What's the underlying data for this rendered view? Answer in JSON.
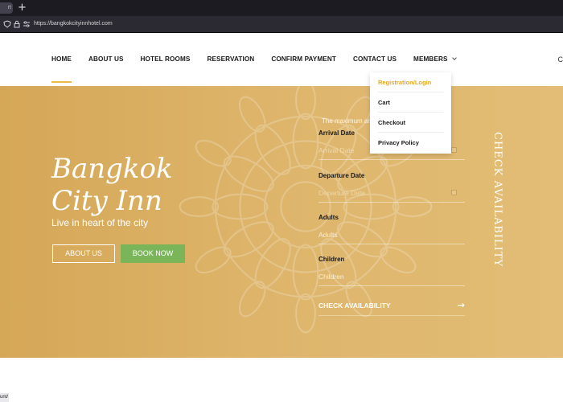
{
  "browser": {
    "tab_stub_label": "rt",
    "new_tab_symbol": "+",
    "url": "https://bangkokcityinnhotel.com",
    "status_text": "unt/"
  },
  "nav": {
    "items": [
      {
        "label": "HOME"
      },
      {
        "label": "ABOUT US"
      },
      {
        "label": "HOTEL ROOMS"
      },
      {
        "label": "RESERVATION"
      },
      {
        "label": "CONFIRM PAYMENT"
      },
      {
        "label": "CONTACT US"
      },
      {
        "label": "MEMBERS"
      }
    ],
    "edge_glyph": "C"
  },
  "dropdown": {
    "items": [
      {
        "label": "Registration/Login"
      },
      {
        "label": "Cart"
      },
      {
        "label": "Checkout"
      },
      {
        "label": "Privacy Policy"
      }
    ]
  },
  "hero": {
    "brand_line1": "Bangkok",
    "brand_line2": "City Inn",
    "tagline": "Live in heart of the city",
    "about_button": "ABOUT US",
    "book_button": "BOOK NOW"
  },
  "form": {
    "notice": "The maximum am                                   room is 2 persons",
    "arrival_label": "Arrival Date",
    "arrival_placeholder": "Arrival Date",
    "departure_label": "Departure Date",
    "departure_placeholder": "Departure Date",
    "adults_label": "Adults",
    "adults_value": "Adults",
    "children_label": "Children",
    "children_value": "Children",
    "check_button": "CHECK AVAILABILITY",
    "vertical_title": "CHECK AVAILABILITY"
  },
  "colors": {
    "accent": "#e9b949",
    "hero_bg": "#d9ad62",
    "book_button": "#7bb55a",
    "dropdown_highlight": "#e6a823"
  },
  "icons": {
    "lock": "lock-icon",
    "shield": "shield-icon",
    "calendar": "calendar-icon",
    "arrow": "arrow-right-icon",
    "chevron": "chevron-down-icon"
  }
}
